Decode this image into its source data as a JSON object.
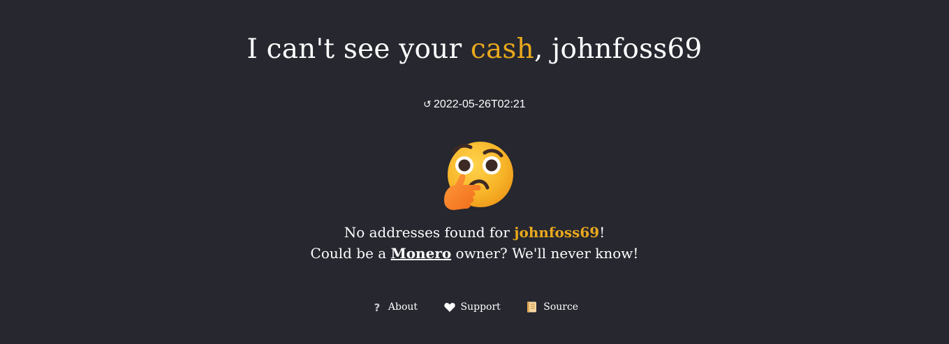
{
  "header": {
    "title_prefix": "I can't see your ",
    "title_accent": "cash",
    "title_suffix": ", johnfoss69"
  },
  "timestamp": {
    "icon": "history-icon",
    "value": "2022-05-26T02:21"
  },
  "illustration": {
    "icon": "thinking-face-emoji"
  },
  "message": {
    "line1_prefix": "No addresses found for ",
    "line1_user": "johnfoss69",
    "line1_suffix": "!",
    "line2_prefix": "Could be a ",
    "line2_link": "Monero",
    "line2_suffix": " owner? We'll never know!"
  },
  "footer": {
    "links": [
      {
        "label": "About",
        "icon": "question-icon"
      },
      {
        "label": "Support",
        "icon": "heart-icon"
      },
      {
        "label": "Source",
        "icon": "scroll-icon"
      }
    ]
  },
  "colors": {
    "background": "#26272f",
    "accent": "#e9a81d",
    "text": "#ffffff"
  }
}
